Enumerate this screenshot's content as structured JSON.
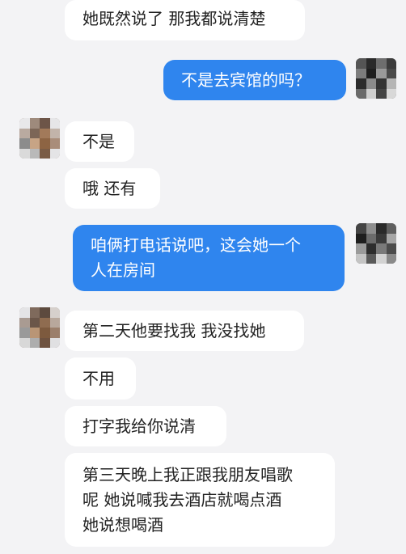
{
  "conversation": {
    "messages": [
      {
        "sender": "other",
        "text": "她既然说了 那我都说清楚"
      },
      {
        "sender": "me",
        "text": "不是去宾馆的吗？"
      },
      {
        "sender": "other",
        "text": "不是"
      },
      {
        "sender": "other",
        "text": "哦 还有"
      },
      {
        "sender": "me",
        "text": "咱俩打电话说吧，这会她一个\n人在房间"
      },
      {
        "sender": "other",
        "text": "第二天他要找我 我没找她"
      },
      {
        "sender": "other",
        "text": "不用"
      },
      {
        "sender": "other",
        "text": "打字我给你说清"
      },
      {
        "sender": "other",
        "text": "第三天晚上我正跟我朋友唱歌\n呢 她说喊我去酒店就喝点酒\n她说想喝酒"
      }
    ]
  },
  "theme": {
    "background": "#f3f3f5",
    "incoming_bubble": "#ffffff",
    "outgoing_bubble": "#2f85ee"
  }
}
